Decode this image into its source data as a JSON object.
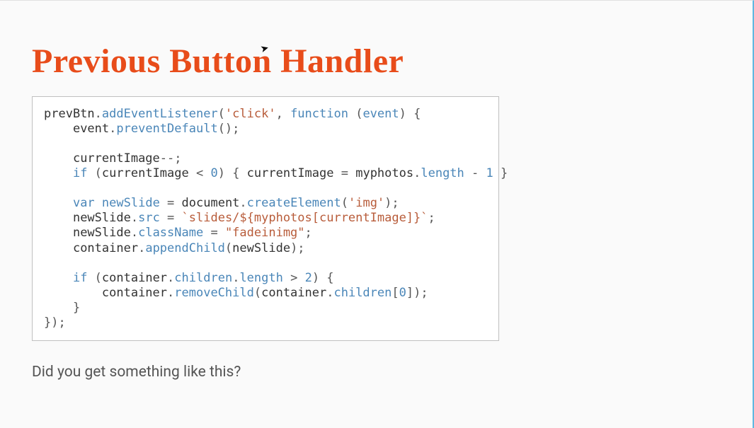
{
  "slide": {
    "title": "Previous Button Handler",
    "caption": "Did you get something like this?"
  },
  "code": {
    "tokens": [
      [
        "ident",
        "prevBtn"
      ],
      [
        "punct",
        "."
      ],
      [
        "method",
        "addEventListener"
      ],
      [
        "punct",
        "("
      ],
      [
        "string",
        "'click'"
      ],
      [
        "punct",
        ", "
      ],
      [
        "keyword",
        "function"
      ],
      [
        "punct",
        " ("
      ],
      [
        "param",
        "event"
      ],
      [
        "punct",
        ") {"
      ],
      [
        "nl",
        ""
      ],
      [
        "indent",
        "    "
      ],
      [
        "ident",
        "event"
      ],
      [
        "punct",
        "."
      ],
      [
        "method",
        "preventDefault"
      ],
      [
        "punct",
        "();"
      ],
      [
        "nl",
        ""
      ],
      [
        "nl",
        ""
      ],
      [
        "indent",
        "    "
      ],
      [
        "ident",
        "currentImage"
      ],
      [
        "punct",
        "--;"
      ],
      [
        "nl",
        ""
      ],
      [
        "indent",
        "    "
      ],
      [
        "keyword",
        "if"
      ],
      [
        "punct",
        " ("
      ],
      [
        "ident",
        "currentImage"
      ],
      [
        "punct",
        " < "
      ],
      [
        "number",
        "0"
      ],
      [
        "punct",
        ") { "
      ],
      [
        "ident",
        "currentImage"
      ],
      [
        "punct",
        " = "
      ],
      [
        "ident",
        "myphotos"
      ],
      [
        "punct",
        "."
      ],
      [
        "method",
        "length"
      ],
      [
        "punct",
        " - "
      ],
      [
        "number",
        "1"
      ],
      [
        "punct",
        " }"
      ],
      [
        "nl",
        ""
      ],
      [
        "nl",
        ""
      ],
      [
        "indent",
        "    "
      ],
      [
        "keyword",
        "var"
      ],
      [
        "punct",
        " "
      ],
      [
        "param",
        "newSlide"
      ],
      [
        "punct",
        " = "
      ],
      [
        "ident",
        "document"
      ],
      [
        "punct",
        "."
      ],
      [
        "method",
        "createElement"
      ],
      [
        "punct",
        "("
      ],
      [
        "string",
        "'img'"
      ],
      [
        "punct",
        ");"
      ],
      [
        "nl",
        ""
      ],
      [
        "indent",
        "    "
      ],
      [
        "ident",
        "newSlide"
      ],
      [
        "punct",
        "."
      ],
      [
        "method",
        "src"
      ],
      [
        "punct",
        " = "
      ],
      [
        "string",
        "`slides/${myphotos[currentImage]}`"
      ],
      [
        "punct",
        ";"
      ],
      [
        "nl",
        ""
      ],
      [
        "indent",
        "    "
      ],
      [
        "ident",
        "newSlide"
      ],
      [
        "punct",
        "."
      ],
      [
        "method",
        "className"
      ],
      [
        "punct",
        " = "
      ],
      [
        "string",
        "\"fadeinimg\""
      ],
      [
        "punct",
        ";"
      ],
      [
        "nl",
        ""
      ],
      [
        "indent",
        "    "
      ],
      [
        "ident",
        "container"
      ],
      [
        "punct",
        "."
      ],
      [
        "method",
        "appendChild"
      ],
      [
        "punct",
        "("
      ],
      [
        "ident",
        "newSlide"
      ],
      [
        "punct",
        ");"
      ],
      [
        "nl",
        ""
      ],
      [
        "nl",
        ""
      ],
      [
        "indent",
        "    "
      ],
      [
        "keyword",
        "if"
      ],
      [
        "punct",
        " ("
      ],
      [
        "ident",
        "container"
      ],
      [
        "punct",
        "."
      ],
      [
        "method",
        "children"
      ],
      [
        "punct",
        "."
      ],
      [
        "method",
        "length"
      ],
      [
        "punct",
        " > "
      ],
      [
        "number",
        "2"
      ],
      [
        "punct",
        ") {"
      ],
      [
        "nl",
        ""
      ],
      [
        "indent",
        "        "
      ],
      [
        "ident",
        "container"
      ],
      [
        "punct",
        "."
      ],
      [
        "method",
        "removeChild"
      ],
      [
        "punct",
        "("
      ],
      [
        "ident",
        "container"
      ],
      [
        "punct",
        "."
      ],
      [
        "method",
        "children"
      ],
      [
        "punct",
        "["
      ],
      [
        "number",
        "0"
      ],
      [
        "punct",
        "]);"
      ],
      [
        "nl",
        ""
      ],
      [
        "indent",
        "    "
      ],
      [
        "punct",
        "}"
      ],
      [
        "nl",
        ""
      ],
      [
        "punct",
        "});"
      ]
    ]
  },
  "colors": {
    "accent": "#e84c1a",
    "code_method": "#4a86b8",
    "code_string": "#b85c3a"
  }
}
